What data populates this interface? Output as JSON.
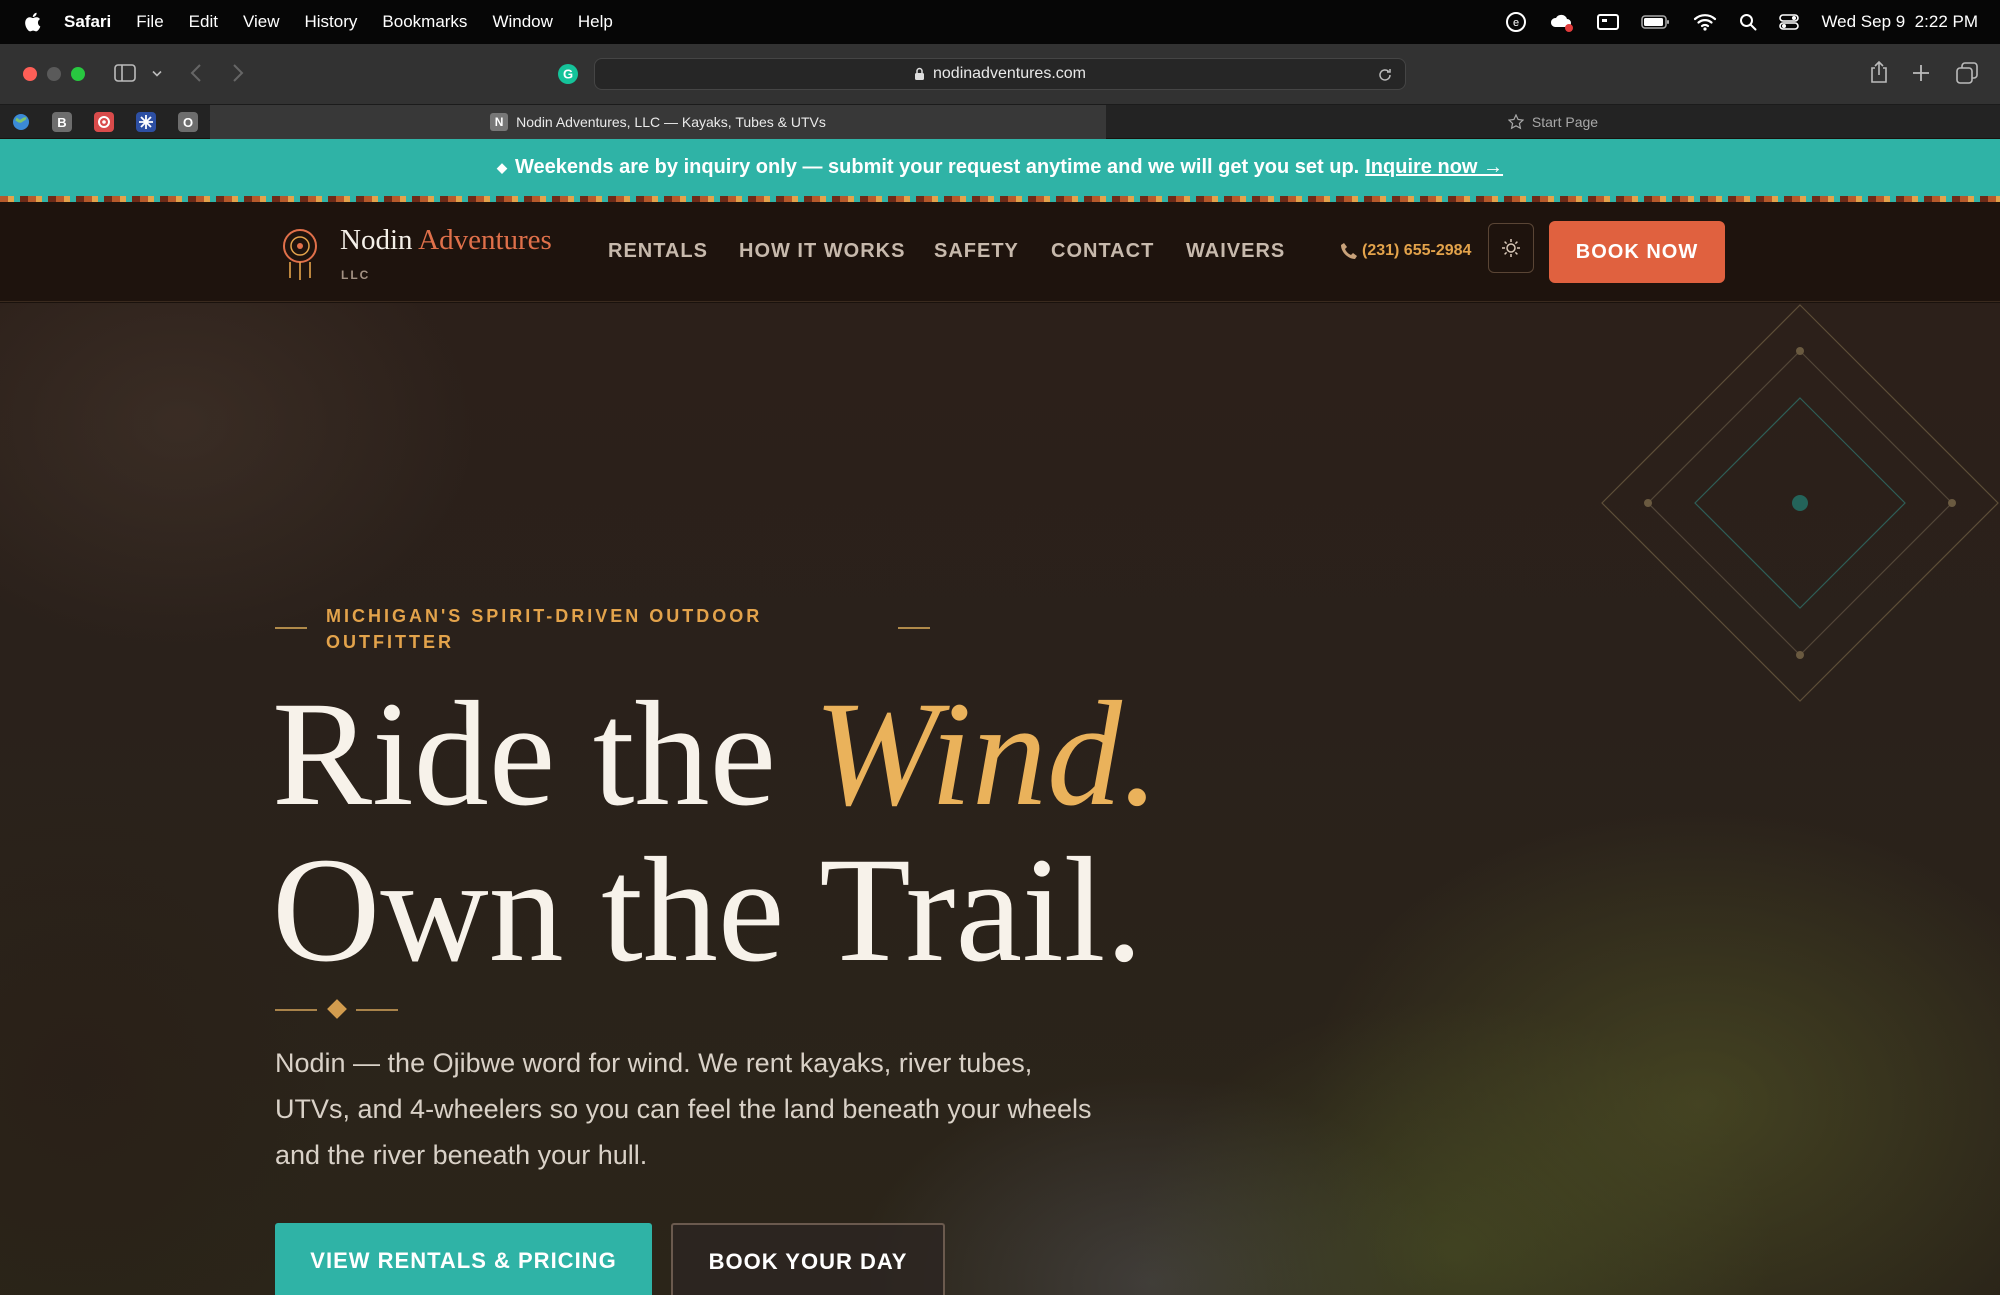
{
  "menubar": {
    "items": [
      "Safari",
      "File",
      "Edit",
      "View",
      "History",
      "Bookmarks",
      "Window",
      "Help"
    ],
    "clock": "Wed Sep 9  2:22 PM"
  },
  "browser": {
    "url": "nodinadventures.com",
    "pinned_tabs": [
      {
        "letter": "",
        "color": "#4a7fc0"
      },
      {
        "letter": "B",
        "color": "#6d6d6d"
      },
      {
        "letter": "",
        "color": "#d94b4b"
      },
      {
        "letter": "",
        "color": "#2d4fa3"
      },
      {
        "letter": "O",
        "color": "#6d6d6d"
      }
    ],
    "active_tab": {
      "favicon_letter": "N",
      "title": "Nodin Adventures, LLC — Kayaks, Tubes & UTVs"
    },
    "inactive_tab": {
      "title": "Start Page"
    }
  },
  "announcement": {
    "text": "Weekends are by inquiry only — submit your request anytime and we will get you set up.",
    "link": "Inquire now →",
    "bullet": "◆"
  },
  "brand": {
    "name_1": "Nodin",
    "name_2": "Adventures",
    "suffix": "LLC"
  },
  "nav": {
    "links": [
      "RENTALS",
      "HOW IT WORKS",
      "SAFETY",
      "CONTACT",
      "WAIVERS"
    ],
    "phone": "(231) 655-2984",
    "book_now": "BOOK NOW"
  },
  "hero": {
    "eyebrow": "MICHIGAN'S SPIRIT-DRIVEN OUTDOOR OUTFITTER",
    "headline_line1_a": "Ride the ",
    "headline_line1_b": "Wind.",
    "headline_line2": "Own the Trail.",
    "subtitle": "Nodin — the Ojibwe word for wind. We rent kayaks, river tubes, UTVs, and 4-wheelers so you can feel the land beneath your wheels and the river beneath your hull.",
    "cta_primary": "VIEW RENTALS & PRICING",
    "cta_secondary": "BOOK YOUR DAY"
  },
  "colors": {
    "teal": "#2fb3a6",
    "terracotta": "#e0613f",
    "gold": "#eab25b",
    "nav_bg": "#1e130d"
  }
}
